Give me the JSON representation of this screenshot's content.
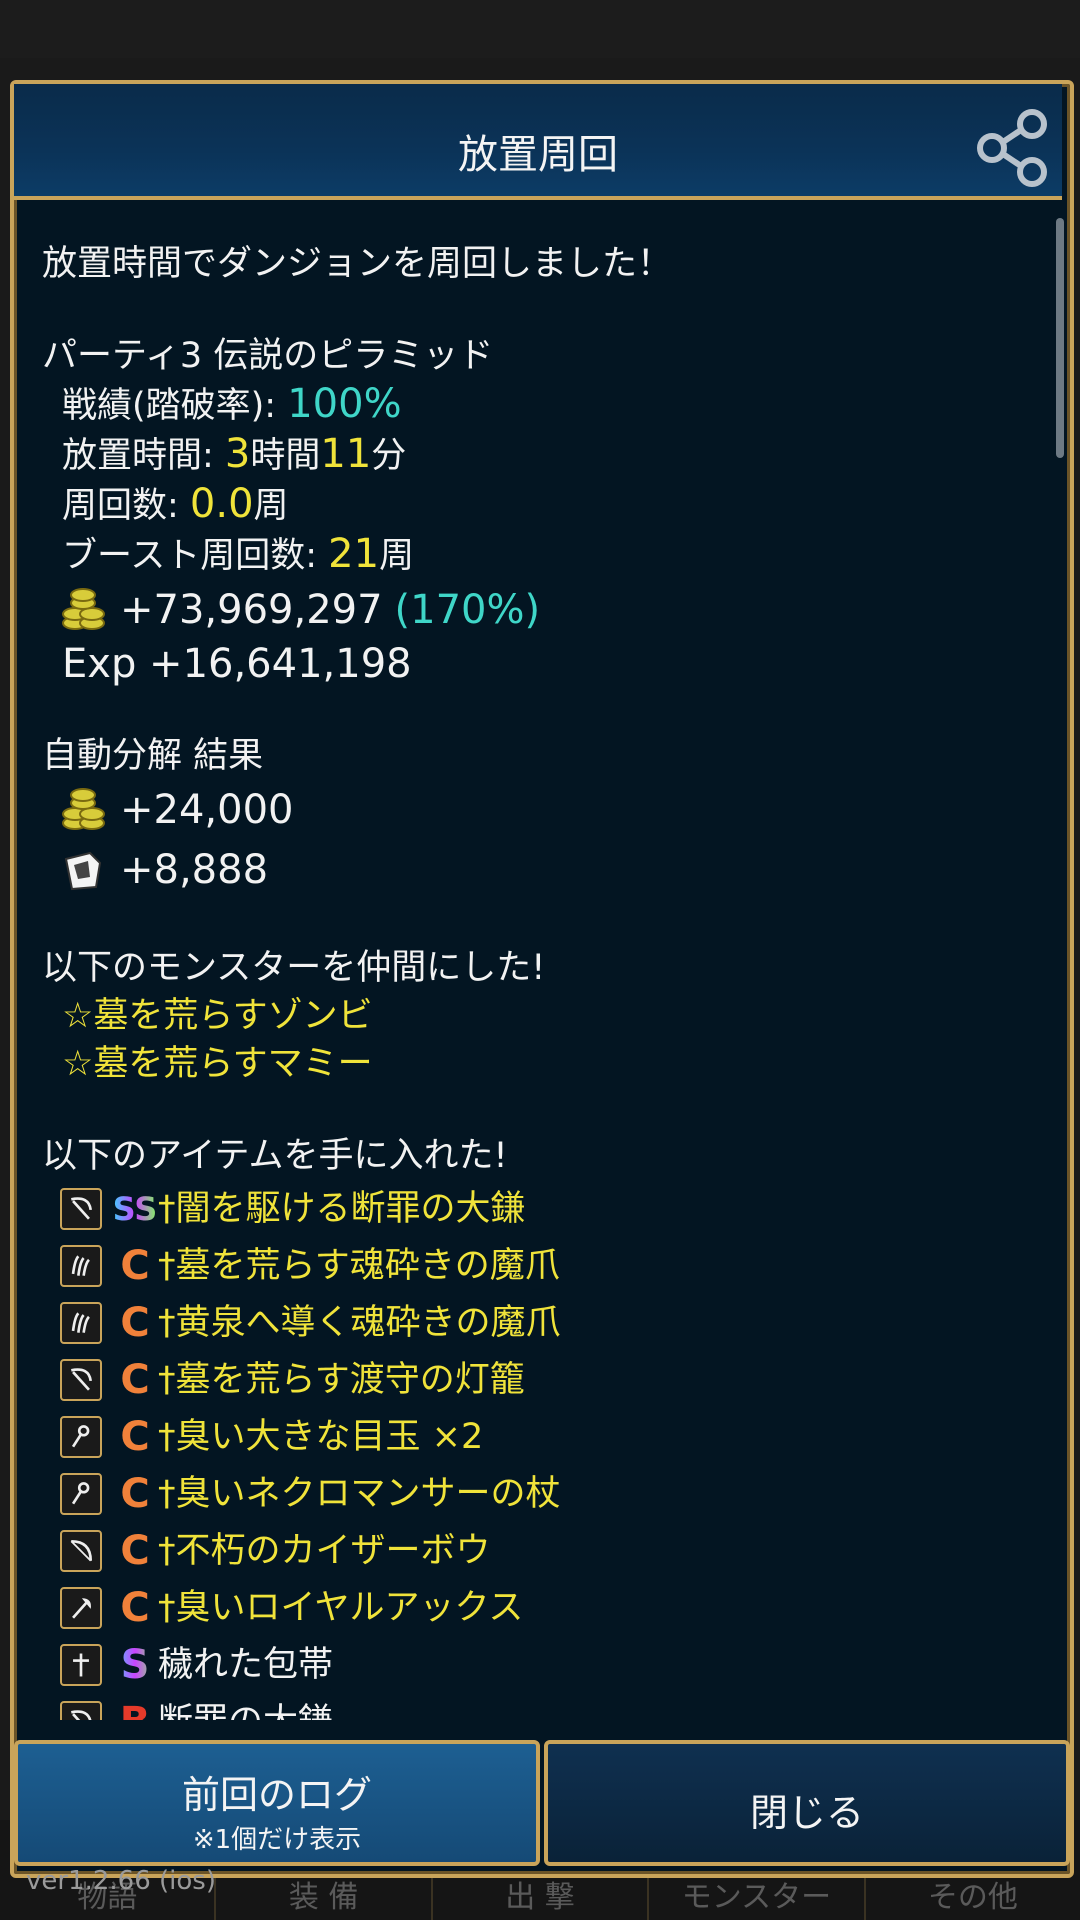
{
  "header": {
    "title": "放置周回"
  },
  "intro": "放置時間でダンジョンを周回しました！",
  "party": {
    "name": "パーティ3 伝説のピラミッド",
    "record_label": "戦績(踏破率): ",
    "record_value": "100%",
    "idle_label": "放置時間: ",
    "idle_hours": "3",
    "idle_hours_unit": "時間",
    "idle_minutes": "11",
    "idle_minutes_unit": "分",
    "laps_label": "周回数: ",
    "laps_value": "0.0",
    "laps_unit": "周",
    "boost_label": "ブースト周回数: ",
    "boost_value": "21",
    "boost_unit": "周",
    "gold": "+73,969,297",
    "gold_pct": "(170%)",
    "exp": "Exp +16,641,198"
  },
  "decompose": {
    "title": "自動分解 結果",
    "gold": "+24,000",
    "material": "+8,888"
  },
  "monsters": {
    "title": "以下のモンスターを仲間にした!",
    "items": [
      "☆墓を荒らすゾンビ",
      "☆墓を荒らすマミー"
    ]
  },
  "items": {
    "title": "以下のアイテムを手に入れた!",
    "list": [
      {
        "grade": "SS",
        "name": "†闇を駆ける断罪の大鎌",
        "icon": "scythe-icon"
      },
      {
        "grade": "C",
        "name": "†墓を荒らす魂砕きの魔爪",
        "icon": "claw-icon"
      },
      {
        "grade": "C",
        "name": "†黄泉へ導く魂砕きの魔爪",
        "icon": "claw-icon"
      },
      {
        "grade": "C",
        "name": "†墓を荒らす渡守の灯籠",
        "icon": "scythe-icon"
      },
      {
        "grade": "C",
        "name": "†臭い大きな目玉 ×2",
        "icon": "staff-icon"
      },
      {
        "grade": "C",
        "name": "†臭いネクロマンサーの杖",
        "icon": "staff-icon"
      },
      {
        "grade": "C",
        "name": "†不朽のカイザーボウ",
        "icon": "bow-icon"
      },
      {
        "grade": "C",
        "name": "†臭いロイヤルアックス",
        "icon": "axe-icon"
      },
      {
        "grade": "S",
        "name": "穢れた包帯",
        "icon": "cross-icon"
      },
      {
        "grade": "B",
        "name": "断罪の大鎌",
        "icon": "scythe-icon"
      }
    ]
  },
  "buttons": {
    "prev_log": "前回のログ",
    "prev_log_note": "※1個だけ表示",
    "close": "閉じる"
  },
  "version": "ver1.2.66 (ios)",
  "nav": [
    "物語",
    "装 備",
    "出 撃",
    "モンスター",
    "その他"
  ],
  "colors": {
    "accent_gold": "#c9a45a",
    "yellow": "#f0e33a",
    "cyan": "#3fd6c8",
    "grade_c": "#f0813a",
    "grade_b": "#e53a2a"
  }
}
